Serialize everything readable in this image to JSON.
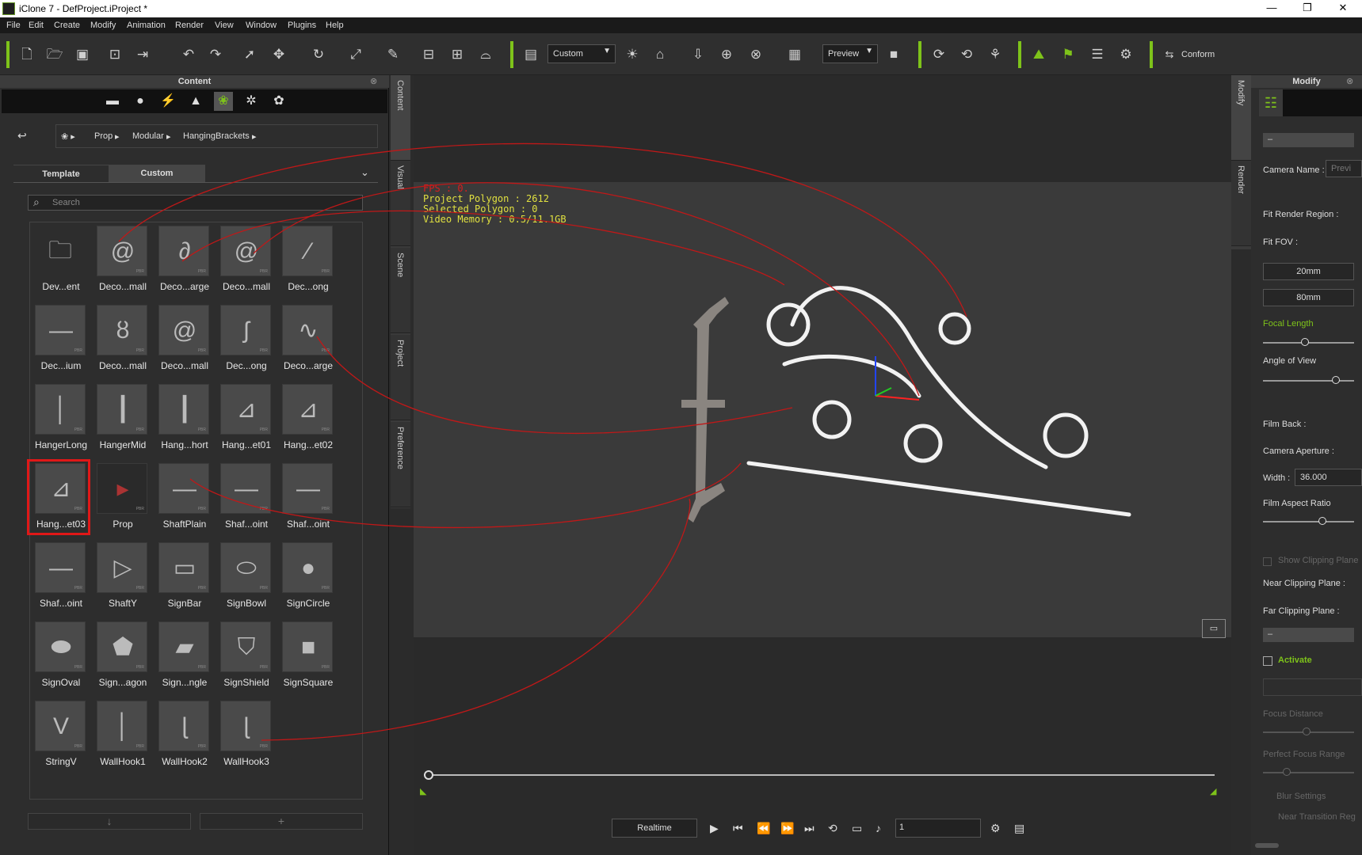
{
  "window": {
    "title": "iClone 7 - DefProject.iProject *",
    "min": "—",
    "max": "❐",
    "close": "✕"
  },
  "menu": [
    "File",
    "Edit",
    "Create",
    "Modify",
    "Animation",
    "Render",
    "View",
    "Window",
    "Plugins",
    "Help"
  ],
  "toolbar": {
    "preset": "Custom",
    "render_mode": "Preview",
    "conform": "Conform"
  },
  "content_panel": {
    "title": "Content",
    "breadcrumb": [
      "Prop",
      "Modular",
      "HangingBrackets"
    ],
    "tabs": [
      "Template",
      "Custom"
    ],
    "active_tab": "Custom",
    "search_placeholder": "Search",
    "items": [
      "Dev...ent",
      "Deco...mall",
      "Deco...arge",
      "Deco...mall",
      "Dec...ong",
      "Dec...ium",
      "Deco...mall",
      "Deco...mall",
      "Dec...ong",
      "Deco...arge",
      "HangerLong",
      "HangerMid",
      "Hang...hort",
      "Hang...et01",
      "Hang...et02",
      "Hang...et03",
      "Prop",
      "ShaftPlain",
      "Shaf...oint",
      "Shaf...oint",
      "Shaf...oint",
      "ShaftY",
      "SignBar",
      "SignBowl",
      "SignCircle",
      "SignOval",
      "Sign...agon",
      "Sign...ngle",
      "SignShield",
      "SignSquare",
      "StringV",
      "WallHook1",
      "WallHook2",
      "WallHook3"
    ],
    "selected_item": "Hang...et03",
    "down_button": "↓",
    "add_button": "+"
  },
  "side_tabs": [
    "Content",
    "Visual",
    "Scene",
    "Project",
    "Preference"
  ],
  "viewport": {
    "fps": "FPS : 0.",
    "polygon": "Project Polygon : 2612",
    "selected": "Selected Polygon : 0",
    "memory": "Video Memory : 0.5/11.1GB"
  },
  "playback": {
    "mode": "Realtime",
    "frame": "1"
  },
  "right_tabs": [
    "Modify",
    "Render"
  ],
  "modify_panel": {
    "title": "Modify",
    "camera_name": "Camera Name :",
    "camera_name_value": "Previ",
    "fit_render": "Fit Render Region :",
    "fit_fov": "Fit FOV :",
    "lens_20": "20mm",
    "lens_80": "80mm",
    "focal_length": "Focal Length",
    "angle_of_view": "Angle of View",
    "film_back": "Film Back :",
    "camera_aperture": "Camera Aperture :",
    "width_label": "Width :",
    "width_value": "36.000",
    "film_aspect": "Film Aspect Ratio",
    "show_clipping": "Show Clipping Plane",
    "near_clip": "Near Clipping Plane :",
    "far_clip": "Far Clipping Plane :",
    "activate": "Activate",
    "focus_distance": "Focus Distance",
    "perfect_focus": "Perfect Focus Range",
    "blur_settings": "Blur Settings",
    "near_transition": "Near Transition Reg",
    "collapse": "–"
  },
  "accent": "#7ec31a",
  "highlight": "#e01818"
}
